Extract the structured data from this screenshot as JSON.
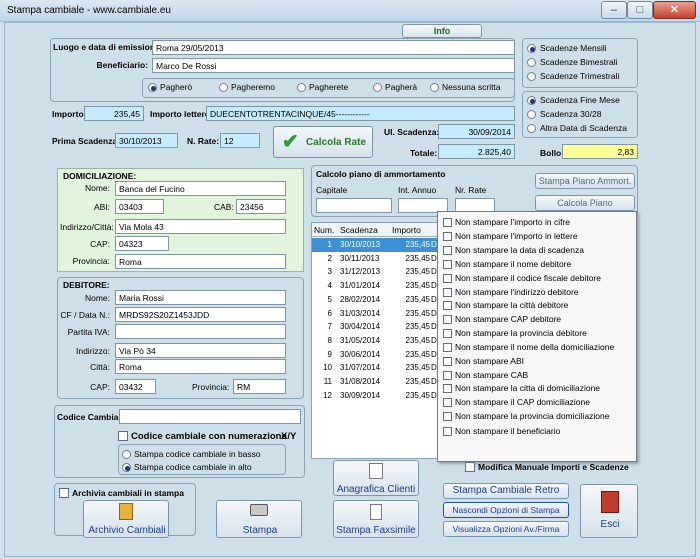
{
  "window": {
    "title": "Stampa cambiale - www.cambiale.eu"
  },
  "info_tab": "Info",
  "header": {
    "luogo_label": "Luogo e data di emissione:",
    "luogo_value": "Roma 29/05/2013",
    "beneficiario_label": "Beneficiario:",
    "beneficiario_value": "Marco De Rossi",
    "tense_options": [
      "Pagherò",
      "Pagheremo",
      "Pagherete",
      "Pagherà",
      "Nessuna scritta"
    ]
  },
  "scadenze": {
    "options": [
      "Scadenze Mensili",
      "Scadenze Bimestrali",
      "Scadenze Trimestrali"
    ]
  },
  "fine": {
    "options": [
      "Scadenza Fine Mese",
      "Scadenza 30/28",
      "Altra Data di Scadenza"
    ]
  },
  "importo": {
    "label": "Importo:",
    "value": "235,45",
    "lettere_label": "Importo lettere:",
    "lettere_value": "DUECENTOTRENTACINQUE/45------------"
  },
  "prima": {
    "label": "Prima Scadenza:",
    "value": "30/10/2013",
    "nrate_label": "N. Rate:",
    "nrate_value": "12",
    "calcola": "Calcola Rate"
  },
  "ultima": {
    "label": "Ul. Scadenza:",
    "value": "30/09/2014",
    "totale_label": "Totale:",
    "totale_value": "2.825,40",
    "bollo_label": "Bollo:",
    "bollo_value": "2,83"
  },
  "domiciliazione": {
    "title": "DOMICILIAZIONE:",
    "nome_label": "Nome:",
    "nome": "Banca del Fucino",
    "abi_label": "ABI:",
    "abi": "03403",
    "cab_label": "CAB:",
    "cab": "23456",
    "indirizzo_label": "Indirizzo/Città:",
    "indirizzo": "Via Mola 43",
    "cap_label": "CAP:",
    "cap": "04323",
    "provincia_label": "Provincia:",
    "provincia": "Roma"
  },
  "debitore": {
    "title": "DEBITORE:",
    "nome_label": "Nome:",
    "nome": "Maria Rossi",
    "cf_label": "CF / Data N.:",
    "cf": "MRDS92S20Z1453JDD",
    "piva_label": "Partita IVA:",
    "piva": "",
    "indirizzo_label": "Indirizzo:",
    "indirizzo": "Via Pò 34",
    "citta_label": "Città:",
    "citta": "Roma",
    "cap_label": "CAP:",
    "cap": "03432",
    "provincia_label": "Provincia:",
    "provincia": "RM"
  },
  "codice": {
    "label": "Codice Cambiale:",
    "numerazione": "Codice cambiale con numerazione",
    "xy": "X/Y",
    "basso": "Stampa codice cambiale in basso",
    "alto": "Stampa codice cambiale in alto"
  },
  "piano": {
    "title": "Calcolo piano di ammortamento",
    "capitale": "Capitale",
    "interesse": "Int. Annuo",
    "nrate": "Nr. Rate",
    "stampa_btn": "Stampa Piano Ammort.",
    "calcola_btn": "Calcola Piano"
  },
  "table": {
    "headers": [
      "Num.",
      "Scadenza",
      "Importo"
    ],
    "rows": [
      [
        "1",
        "30/10/2013",
        "235,45",
        "D"
      ],
      [
        "2",
        "30/11/2013",
        "235,45",
        "D"
      ],
      [
        "3",
        "31/12/2013",
        "235,45",
        "D"
      ],
      [
        "4",
        "31/01/2014",
        "235,45",
        "D"
      ],
      [
        "5",
        "28/02/2014",
        "235,45",
        "D"
      ],
      [
        "6",
        "31/03/2014",
        "235,45",
        "D"
      ],
      [
        "7",
        "30/04/2014",
        "235,45",
        "D"
      ],
      [
        "8",
        "31/05/2014",
        "235,45",
        "D"
      ],
      [
        "9",
        "30/06/2014",
        "235,45",
        "D"
      ],
      [
        "10",
        "31/07/2014",
        "235,45",
        "D"
      ],
      [
        "11",
        "31/08/2014",
        "235,45",
        "D"
      ],
      [
        "12",
        "30/09/2014",
        "235,45",
        "D"
      ]
    ]
  },
  "menu": {
    "group1": [
      "Non stampare l'importo in cifre",
      "Non stampare l'importo in lettere",
      "Non stampare la data di scadenza"
    ],
    "group2": [
      "Non stampare il nome debitore",
      "Non stampare il codice fiscale debitore",
      "Non stampare l'indirizzo debitore",
      "Non stampare la città debitore",
      "Non stampare CAP debitore",
      "Non stampare la provincia debitore"
    ],
    "group3": [
      "Non stampare il nome della domiciliazione",
      "Non stampare ABI",
      "Non stampare CAB",
      "Non stampare la citta di domiciliazione",
      "Non stampare il CAP domiciliazione",
      "Non stampare la provincia domiciliazione"
    ],
    "group4": [
      "Non stampare il beneficiario"
    ]
  },
  "modifica": "Modifica Manuale Importi e Scadenze",
  "buttons": {
    "archivia": "Archivia cambiali in stampa",
    "archivio": "Archivio Cambiali",
    "stampa": "Stampa",
    "anagrafica": "Anagrafica Clienti",
    "faxsimile": "Stampa Faxsimile",
    "retro": "Stampa Cambiale Retro",
    "nascondi": "Nascondi Opzioni di Stampa",
    "visualizza": "Visualizza Opzioni Av./Firma",
    "esci": "Esci"
  }
}
